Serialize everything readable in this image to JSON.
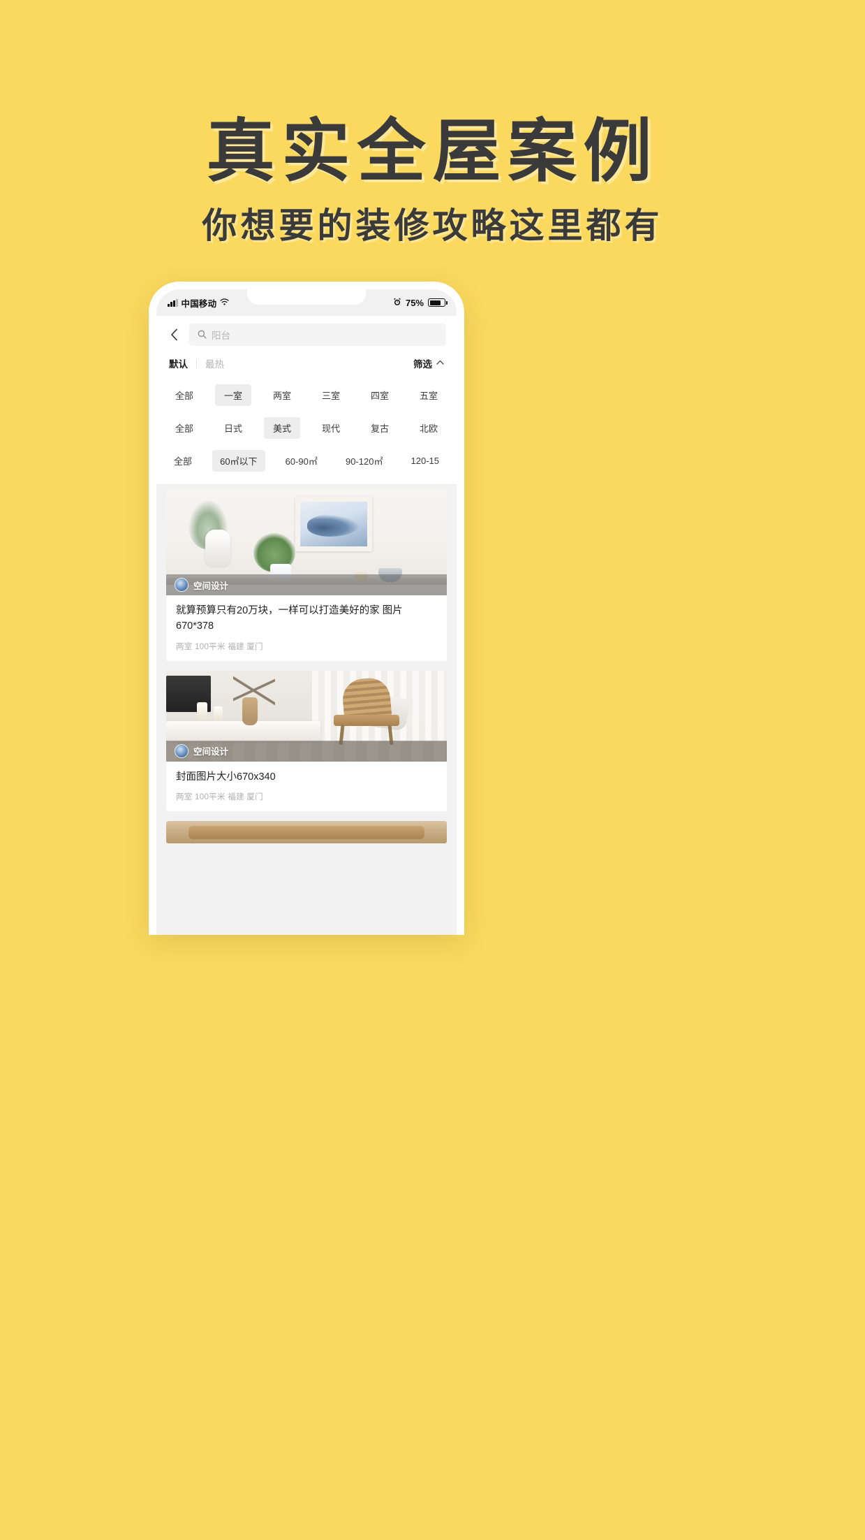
{
  "promo": {
    "headline": "真实全屋案例",
    "subheadline": "你想要的装修攻略这里都有",
    "background_color": "#fbd95e",
    "text_color": "#3a3a3a"
  },
  "phone": {
    "status_bar": {
      "carrier": "中国移动",
      "signal_icon": "signal-bars-icon",
      "wifi_icon": "wifi-icon",
      "alarm_icon": "alarm-clock-icon",
      "battery_percent": "75%",
      "battery_icon": "battery-icon"
    },
    "nav": {
      "back_icon": "chevron-left-icon",
      "search_icon": "search-icon",
      "search_placeholder": "阳台",
      "search_value": ""
    },
    "sort": {
      "items": [
        {
          "label": "默认",
          "active": true
        },
        {
          "label": "最热",
          "active": false
        }
      ],
      "filter_label": "筛选",
      "filter_caret_icon": "chevron-up-icon"
    },
    "filters": [
      {
        "name": "room-count",
        "chips": [
          {
            "label": "全部",
            "selected": false
          },
          {
            "label": "一室",
            "selected": true
          },
          {
            "label": "两室",
            "selected": false
          },
          {
            "label": "三室",
            "selected": false
          },
          {
            "label": "四室",
            "selected": false
          },
          {
            "label": "五室",
            "selected": false
          }
        ]
      },
      {
        "name": "style",
        "chips": [
          {
            "label": "全部",
            "selected": false
          },
          {
            "label": "日式",
            "selected": false
          },
          {
            "label": "美式",
            "selected": true
          },
          {
            "label": "现代",
            "selected": false
          },
          {
            "label": "复古",
            "selected": false
          },
          {
            "label": "北欧",
            "selected": false
          }
        ]
      },
      {
        "name": "area",
        "chips": [
          {
            "label": "全部",
            "selected": false
          },
          {
            "label": "60㎡以下",
            "selected": true
          },
          {
            "label": "60-90㎡",
            "selected": false
          },
          {
            "label": "90-120㎡",
            "selected": false
          },
          {
            "label": "120-15",
            "selected": false
          }
        ]
      }
    ],
    "feed": [
      {
        "badge": "空间设计",
        "title": "就算预算只有20万块，一样可以打造美好的家  图片670*378",
        "meta": "两室  100平米  福建 厦门"
      },
      {
        "badge": "空间设计",
        "title": "封面图片大小670x340",
        "meta": "两室  100平米  福建 厦门"
      },
      {
        "badge": "",
        "title": "",
        "meta": ""
      }
    ]
  }
}
